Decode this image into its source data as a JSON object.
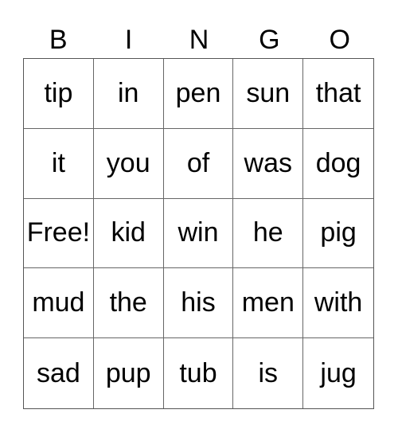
{
  "headers": [
    "B",
    "I",
    "N",
    "G",
    "O"
  ],
  "cells": [
    [
      "tip",
      "in",
      "pen",
      "sun",
      "that"
    ],
    [
      "it",
      "you",
      "of",
      "was",
      "dog"
    ],
    [
      "Free!",
      "kid",
      "win",
      "he",
      "pig"
    ],
    [
      "mud",
      "the",
      "his",
      "men",
      "with"
    ],
    [
      "sad",
      "pup",
      "tub",
      "is",
      "jug"
    ]
  ]
}
